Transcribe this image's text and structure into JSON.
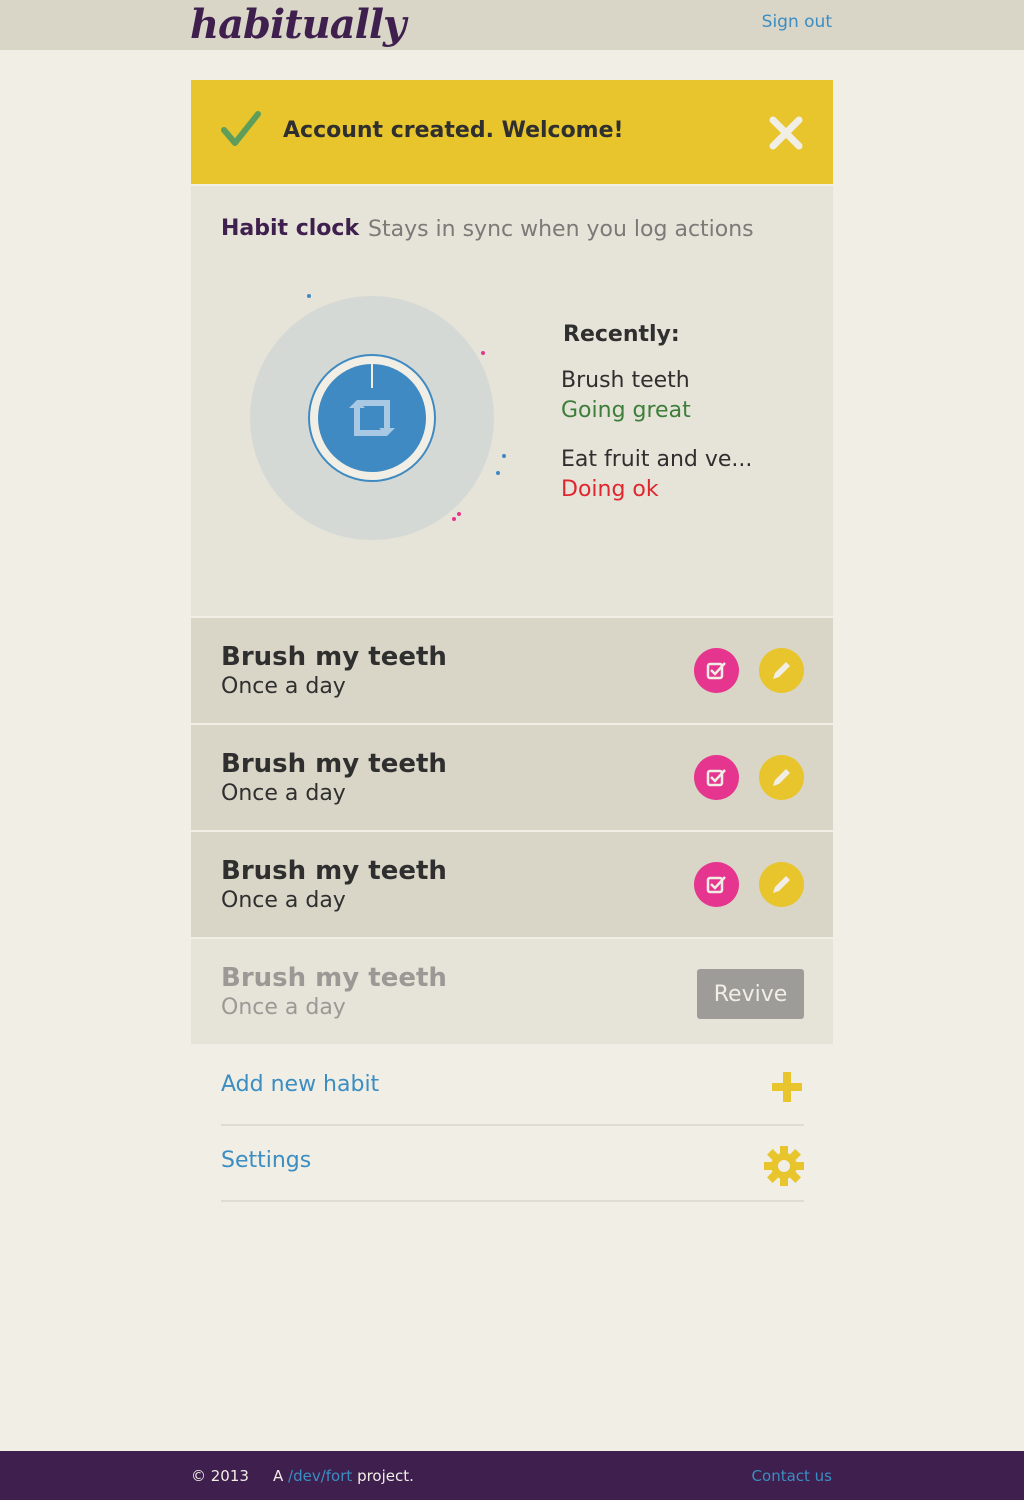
{
  "header": {
    "logo": "habitually",
    "sign_out": "Sign out"
  },
  "flash": {
    "message": "Account created. Welcome!"
  },
  "clock": {
    "title": "Habit clock",
    "subtitle": "Stays in sync when you log actions",
    "recently_label": "Recently:",
    "recent": [
      {
        "name": "Brush teeth",
        "status": "Going great",
        "status_color": "#3d7e3b"
      },
      {
        "name": "Eat fruit and ve...",
        "status": "Doing ok",
        "status_color": "#e0262e"
      }
    ]
  },
  "habits": [
    {
      "name": "Brush my teeth",
      "frequency": "Once a day"
    },
    {
      "name": "Brush my teeth",
      "frequency": "Once a day"
    },
    {
      "name": "Brush my teeth",
      "frequency": "Once a day"
    },
    {
      "name": "Brush my teeth",
      "frequency": "Once a day",
      "revive_label": "Revive"
    }
  ],
  "links": {
    "add_habit": "Add new habit",
    "settings": "Settings"
  },
  "footer": {
    "copyright": "© 2013",
    "project_prefix": "A",
    "project_link": "/dev/fort",
    "project_suffix": "project.",
    "contact": "Contact us"
  },
  "colors": {
    "accent_purple": "#3e1f4d",
    "accent_yellow": "#e8c52c",
    "accent_pink": "#e5358e",
    "link_blue": "#3b8dc2",
    "clock_blue": "#3f8ac2"
  },
  "icons": {
    "flash_icon": "check-icon",
    "flash_close": "close-icon",
    "clock_center": "repeat-icon",
    "log_button": "checkbox-icon",
    "edit_button": "pencil-icon",
    "add_link": "plus-icon",
    "settings_link": "gear-icon"
  }
}
